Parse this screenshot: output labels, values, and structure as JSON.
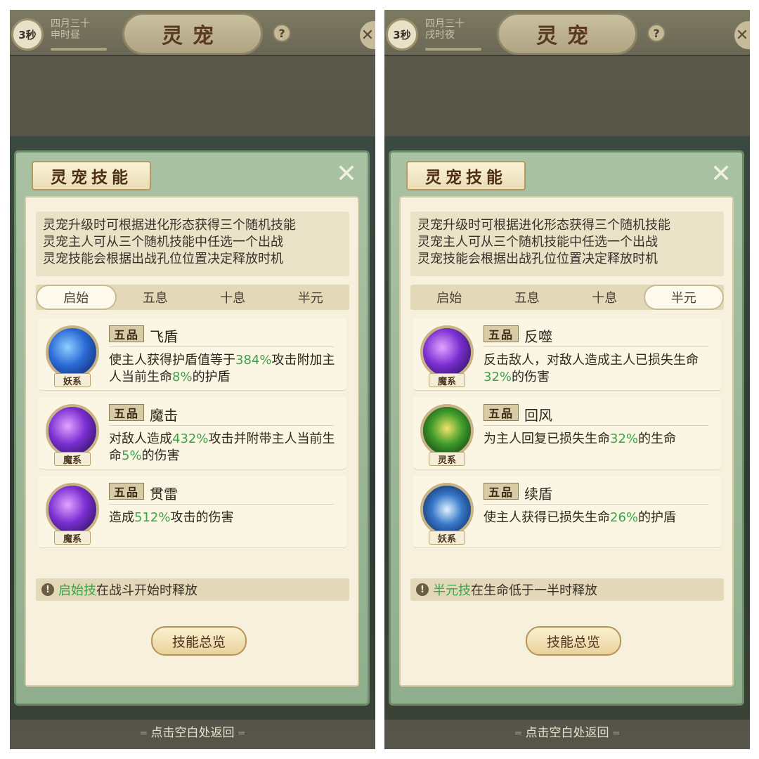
{
  "screens": [
    {
      "timer": "3秒",
      "date_line1": "四月三十",
      "date_line2": "申时昼",
      "title": "灵宠",
      "help": "?",
      "panel_title": "灵宠技能",
      "description": [
        "灵宠升级时可根据进化形态获得三个随机技能",
        "灵宠主人可从三个随机技能中任选一个出战",
        "灵宠技能会根据出战孔位位置决定释放时机"
      ],
      "tabs": [
        "启始",
        "五息",
        "十息",
        "半元"
      ],
      "active_tab": "启始",
      "skills": [
        {
          "class": "妖系",
          "grade": "五品",
          "name": "飞盾",
          "desc": [
            "使主人获得护盾值等于",
            "384%",
            "攻击附加主人当前生命",
            "8%",
            "的护盾"
          ]
        },
        {
          "class": "魔系",
          "grade": "五品",
          "name": "魔击",
          "desc": [
            "对敌人造成",
            "432%",
            "攻击并附带主人当前生命",
            "5%",
            "的伤害"
          ]
        },
        {
          "class": "魔系",
          "grade": "五品",
          "name": "贯雷",
          "desc": [
            "造成",
            "512%",
            "攻击的伤害",
            "",
            ""
          ]
        }
      ],
      "note_highlight": "启始技",
      "note_text": "在战斗开始时释放",
      "overview_button": "技能总览",
      "back_text": "点击空白处返回"
    },
    {
      "timer": "3秒",
      "date_line1": "四月三十",
      "date_line2": "戌时夜",
      "title": "灵宠",
      "help": "?",
      "panel_title": "灵宠技能",
      "description": [
        "灵宠升级时可根据进化形态获得三个随机技能",
        "灵宠主人可从三个随机技能中任选一个出战",
        "灵宠技能会根据出战孔位位置决定释放时机"
      ],
      "tabs": [
        "启始",
        "五息",
        "十息",
        "半元"
      ],
      "active_tab": "半元",
      "skills": [
        {
          "class": "魔系",
          "grade": "五品",
          "name": "反噬",
          "desc": [
            "反击敌人，对敌人造成主人已损失生命",
            "32%",
            "的伤害",
            "",
            ""
          ]
        },
        {
          "class": "灵系",
          "grade": "五品",
          "name": "回风",
          "desc": [
            "为主人回复已损失生命",
            "32%",
            "的生命",
            "",
            ""
          ]
        },
        {
          "class": "妖系",
          "grade": "五品",
          "name": "续盾",
          "desc": [
            "使主人获得已损失生命",
            "26%",
            "的护盾",
            "",
            ""
          ]
        }
      ],
      "note_highlight": "半元技",
      "note_text": "在生命低于一半时释放",
      "overview_button": "技能总览",
      "back_text": "点击空白处返回"
    }
  ],
  "colors": {
    "highlight_green": "#3aa34b",
    "panel_green": "#8fae8c",
    "parchment": "#f6f0dc"
  },
  "icons": [
    "close-icon",
    "help-icon",
    "warning-icon",
    "skill-icon"
  ]
}
